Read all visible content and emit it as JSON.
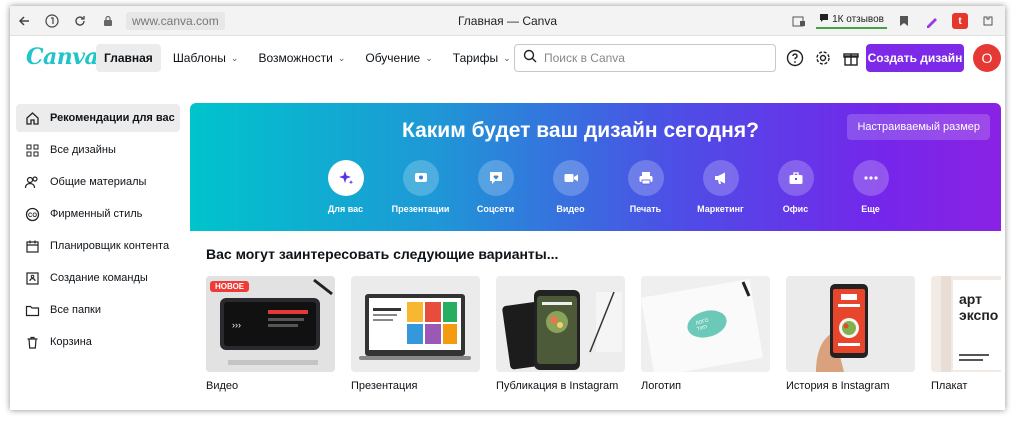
{
  "browser": {
    "url": "www.canva.com",
    "window_title": "Главная — Canva",
    "reviews": "1К отзывов"
  },
  "header": {
    "logo": "Canva",
    "nav": [
      {
        "label": "Главная",
        "active": true,
        "has_menu": false
      },
      {
        "label": "Шаблоны",
        "active": false,
        "has_menu": true
      },
      {
        "label": "Возможности",
        "active": false,
        "has_menu": true
      },
      {
        "label": "Обучение",
        "active": false,
        "has_menu": true
      },
      {
        "label": "Тарифы",
        "active": false,
        "has_menu": true
      }
    ],
    "search_placeholder": "Поиск в Canva",
    "create_button": "Создать дизайн",
    "avatar_letter": "О"
  },
  "sidebar": {
    "items": [
      {
        "label": "Рекомендации для вас",
        "icon": "home-icon",
        "active": true
      },
      {
        "label": "Все дизайны",
        "icon": "grid-icon",
        "active": false
      },
      {
        "label": "Общие материалы",
        "icon": "people-icon",
        "active": false
      },
      {
        "label": "Фирменный стиль",
        "icon": "brand-kit-icon",
        "active": false
      },
      {
        "label": "Планировщик контента",
        "icon": "calendar-icon",
        "active": false
      },
      {
        "label": "Создание команды",
        "icon": "team-icon",
        "active": false
      },
      {
        "label": "Все папки",
        "icon": "folder-icon",
        "active": false
      },
      {
        "label": "Корзина",
        "icon": "trash-icon",
        "active": false
      }
    ]
  },
  "hero": {
    "title": "Каким будет ваш дизайн сегодня?",
    "custom_size_button": "Настраиваемый размер",
    "categories": [
      {
        "label": "Для вас",
        "icon": "sparkle-icon",
        "active": true
      },
      {
        "label": "Презентации",
        "icon": "presentation-icon",
        "active": false
      },
      {
        "label": "Соцсети",
        "icon": "heart-chat-icon",
        "active": false
      },
      {
        "label": "Видео",
        "icon": "video-camera-icon",
        "active": false
      },
      {
        "label": "Печать",
        "icon": "printer-icon",
        "active": false
      },
      {
        "label": "Маркетинг",
        "icon": "megaphone-icon",
        "active": false
      },
      {
        "label": "Офис",
        "icon": "briefcase-icon",
        "active": false
      },
      {
        "label": "Еще",
        "icon": "more-dots-icon",
        "active": false
      }
    ]
  },
  "suggestions": {
    "title": "Вас могут заинтересовать следующие варианты...",
    "new_badge": "НОВОЕ",
    "items": [
      {
        "label": "Видео"
      },
      {
        "label": "Презентация"
      },
      {
        "label": "Публикация в Instagram"
      },
      {
        "label": "Логотип"
      },
      {
        "label": "История в Instagram"
      },
      {
        "label": "Плакат"
      }
    ]
  },
  "colors": {
    "accent": "#7d2ae8",
    "logo": "#20c4cb",
    "avatar": "#e53935"
  }
}
